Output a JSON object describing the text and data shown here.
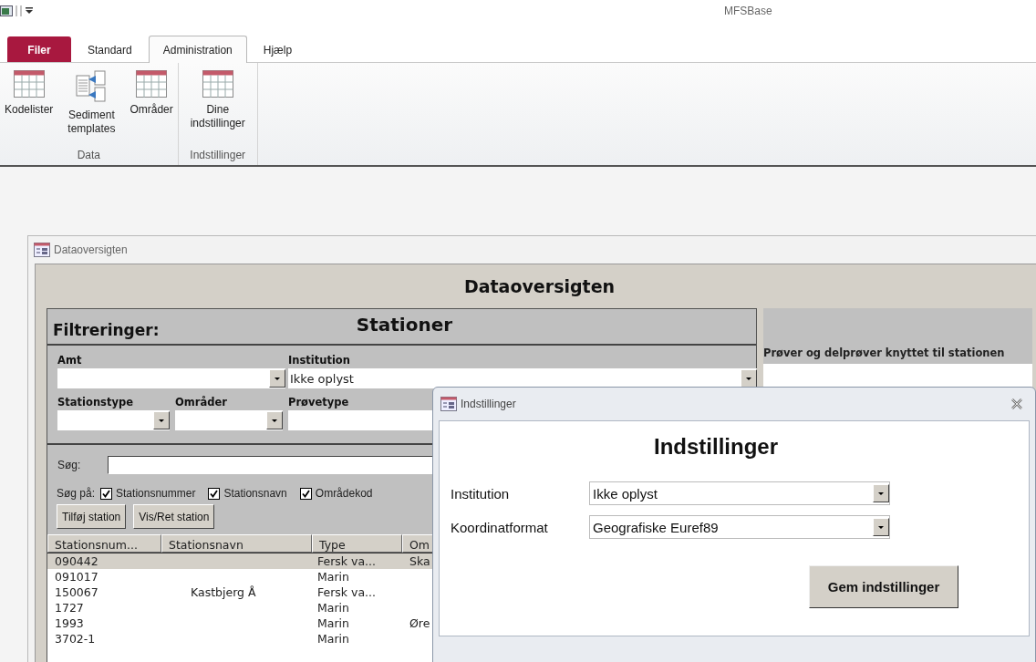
{
  "app_title": "MFSBase",
  "ribbon": {
    "file_tab": "Filer",
    "tabs": [
      {
        "label": "Standard",
        "selected": false
      },
      {
        "label": "Administration",
        "selected": true
      },
      {
        "label": "Hjælp",
        "selected": false
      }
    ],
    "groups": [
      {
        "label": "Data",
        "buttons": [
          {
            "label": "Kodelister",
            "kind": "table"
          },
          {
            "label": "Sediment templates",
            "kind": "document"
          },
          {
            "label": "Områder",
            "kind": "table"
          }
        ]
      },
      {
        "label": "Indstillinger",
        "buttons": [
          {
            "label": "Dine indstillinger",
            "kind": "table"
          }
        ]
      }
    ]
  },
  "form": {
    "title": "Dataoversigten",
    "heading": "Dataoversigten",
    "stations": {
      "filter_label": "Filtreringer:",
      "title": "Stationer",
      "filter_rows": [
        [
          {
            "label": "Amt"
          },
          {
            "label": "Institution",
            "value": "Ikke oplyst"
          }
        ],
        [
          {
            "label": "Stationstype"
          },
          {
            "label": "Områder"
          },
          {
            "label": "Prøvetype"
          }
        ]
      ],
      "search": {
        "label": "Søg:"
      },
      "search_on": {
        "label": "Søg på:",
        "options": [
          {
            "label": "Stationsnummer",
            "checked": true
          },
          {
            "label": "Stationsnavn",
            "checked": true
          },
          {
            "label": "Områdekod",
            "checked": true
          }
        ]
      },
      "buttons": [
        "Tilføj station",
        "Vis/Ret station"
      ],
      "table": {
        "columns": [
          "Stationsnum...",
          "Stationsnavn",
          "Type",
          "Om"
        ],
        "rows": [
          {
            "stationsnummer": "090442",
            "type": "Fersk va...",
            "column_4": "Ska",
            "selected": true
          },
          {
            "stationsnummer": "091017",
            "type": "Marin",
            "selected": false
          },
          {
            "stationsnummer": "150067",
            "stationsnavn": "Kastbjerg Å",
            "type": "Fersk va...",
            "selected": false
          },
          {
            "stationsnummer": "1727",
            "type": "Marin",
            "selected": false
          },
          {
            "stationsnummer": "1993",
            "type": "Marin",
            "column_4": "Øre",
            "selected": false
          },
          {
            "stationsnummer": "3702-1",
            "type": "Marin",
            "selected": false
          }
        ]
      }
    },
    "samples": {
      "title": "Prøver og delprøver knyttet til stationen"
    }
  },
  "dialog": {
    "title": "Indstillinger",
    "heading": "Indstillinger",
    "fields": [
      {
        "label": "Institution",
        "value": "Ikke oplyst"
      },
      {
        "label": "Koordinatformat",
        "value": "Geografiske Euref89"
      }
    ],
    "button": "Gem indstillinger"
  }
}
